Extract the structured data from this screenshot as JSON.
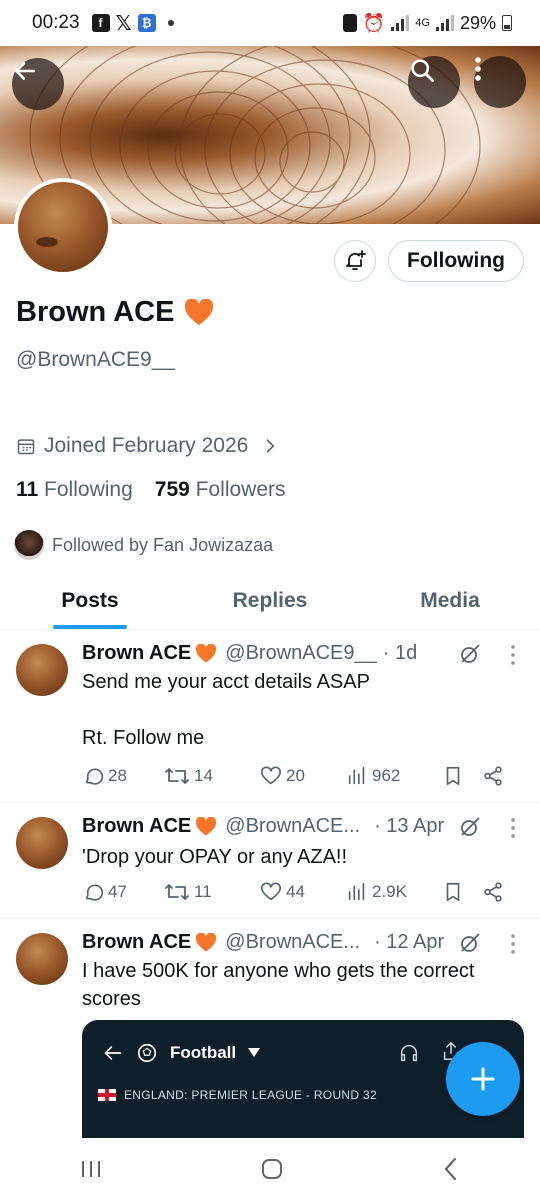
{
  "status_bar": {
    "time": "00:23",
    "network": "4G",
    "battery": "29%"
  },
  "header": {
    "back_icon": "arrow-left-icon",
    "search_icon": "search-icon",
    "more_icon": "more-vertical-icon"
  },
  "profile": {
    "display_name": "Brown ACE",
    "name_emoji": "orange-heart",
    "handle": "@BrownACE9__",
    "joined": "Joined February 2026",
    "following_count": "11",
    "following_label": "Following",
    "followers_count": "759",
    "followers_label": "Followers",
    "followed_by": "Followed by Fan Jowizazaa",
    "follow_button": "Following"
  },
  "tabs": [
    {
      "label": "Posts",
      "active": true
    },
    {
      "label": "Replies",
      "active": false
    },
    {
      "label": "Media",
      "active": false
    }
  ],
  "posts": [
    {
      "name": "Brown ACE",
      "handle": "@BrownACE9__",
      "time": "· 1d",
      "text": "Send me your acct details ASAP\n\nRt. Follow me",
      "replies": "28",
      "reposts": "14",
      "likes": "20",
      "views": "962"
    },
    {
      "name": "Brown ACE",
      "handle": "@BrownACE...",
      "time": "· 13 Apr",
      "text": "'Drop your OPAY or any AZA!!",
      "replies": "47",
      "reposts": "11",
      "likes": "44",
      "views": "2.9K"
    },
    {
      "name": "Brown ACE",
      "handle": "@BrownACE...",
      "time": "· 12 Apr",
      "text": "I have 500K for anyone who gets the correct scores",
      "media": {
        "title": "Football",
        "league": "ENGLAND: PREMIER LEAGUE - ROUND 32"
      }
    }
  ],
  "colors": {
    "accent": "#1d9bf0",
    "secondary_text": "#536471",
    "primary_text": "#0f1419"
  }
}
